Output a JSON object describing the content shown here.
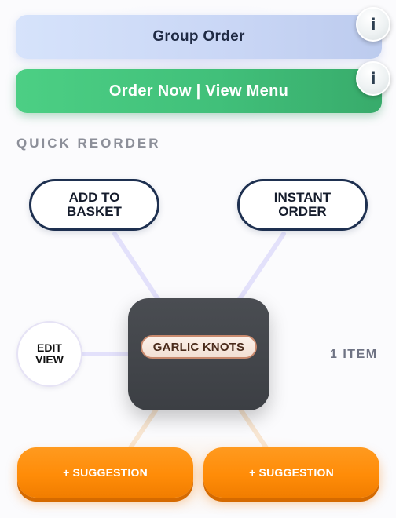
{
  "actions": {
    "group_order": "Group Order",
    "order_now": "Order Now | View Menu",
    "info_label": "i"
  },
  "quick_reorder": {
    "section_title": "QUICK REORDER",
    "add_to_basket_line1": "ADD TO",
    "add_to_basket_line2": "BASKET",
    "instant_order_line1": "INSTANT",
    "instant_order_line2": "ORDER",
    "edit_view_line1": "EDIT",
    "edit_view_line2": "VIEW",
    "item_name": "GARLIC KNOTS",
    "item_count": "1 ITEM",
    "suggestion_1": "+ SUGGESTION",
    "suggestion_2": "+ SUGGESTION"
  },
  "colors": {
    "group_order_bg": "#cfdcf8",
    "order_now_bg": "#41c07a",
    "pill_border": "#1e3050",
    "center_tile": "#46494e",
    "item_chip_border": "#c98a6e",
    "suggestion_bg": "#ff8c08",
    "connector_upper": "#e3e1fb",
    "connector_lower": "#f8e6d2"
  },
  "icons": {
    "info": "info-icon"
  }
}
